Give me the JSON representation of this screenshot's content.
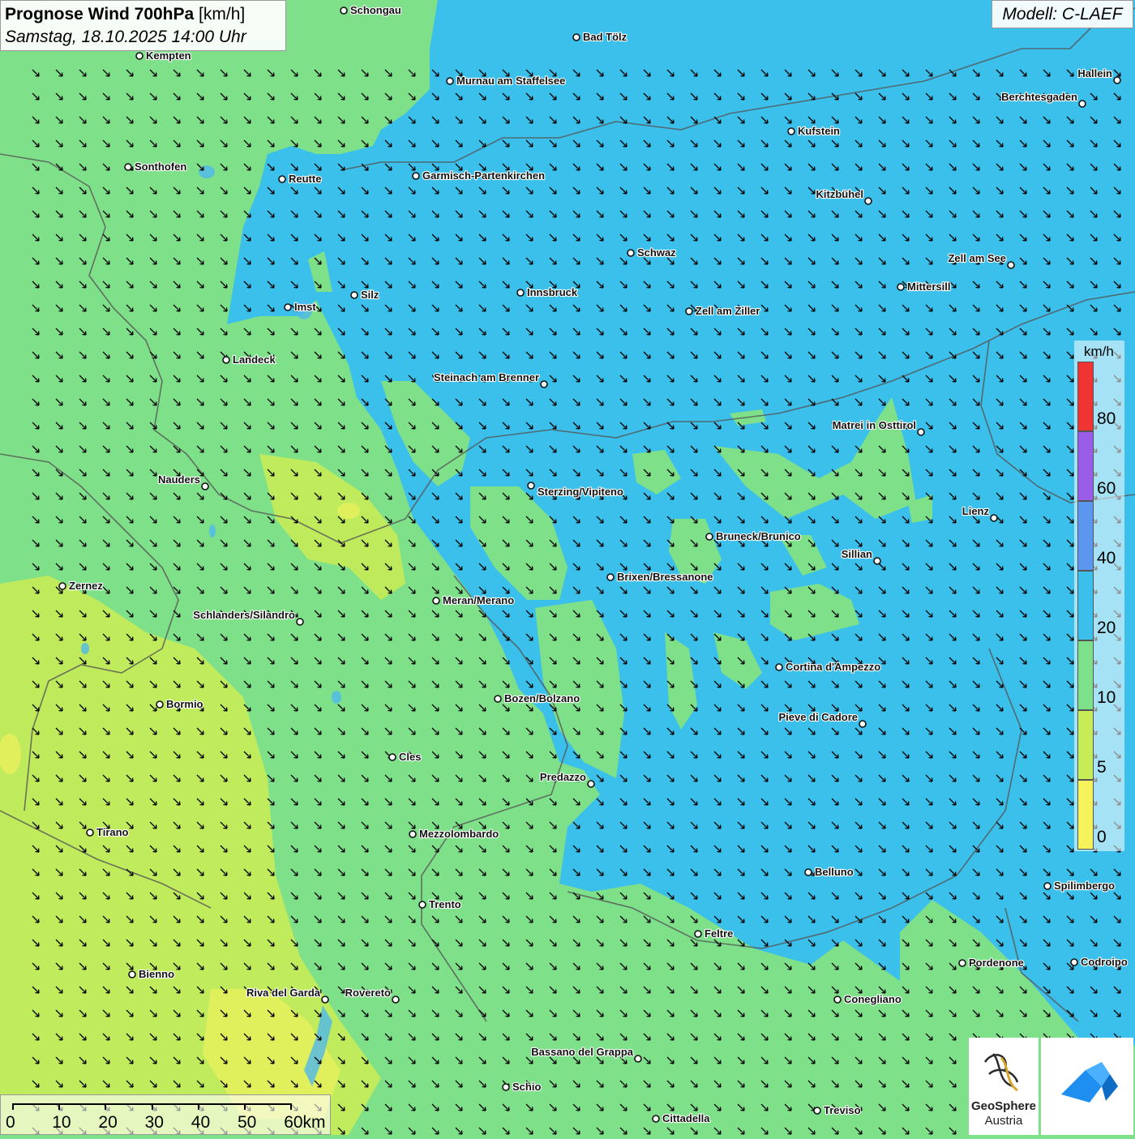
{
  "header": {
    "title": "Prognose Wind 700hPa",
    "unit": "[km/h]",
    "datetime": "Samstag, 18.10.2025 14:00 Uhr"
  },
  "model": "Modell: C-LAEF",
  "legend": {
    "unit": "km/h",
    "ticks": [
      "80",
      "60",
      "40",
      "20",
      "10",
      "5",
      "0"
    ],
    "colors": [
      "#f03434",
      "#9a5de8",
      "#5b97ef",
      "#3bbfeb",
      "#7fe08a",
      "#c6ec57",
      "#f6f25c"
    ]
  },
  "colors": {
    "wind_0_5": "#f6f25c",
    "wind_5_10": "#c6ec57",
    "wind_10_20": "#7fe08a",
    "wind_20_40": "#3bbfeb",
    "border": "#555555",
    "arrow": "#000000"
  },
  "wind_arrows": {
    "direction": "north-west wind blowing to south-east",
    "icon": "arrow-icon"
  },
  "scale_bar": [
    "0",
    "10",
    "20",
    "30",
    "40",
    "50",
    "60km"
  ],
  "logos": {
    "geosphere": "GeoSphere",
    "austria": "Austria"
  },
  "cities": [
    {
      "name": "Schongau"
    },
    {
      "name": "Bad Tölz"
    },
    {
      "name": "Kempten"
    },
    {
      "name": "Murnau am Staffelsee"
    },
    {
      "name": "Hallein"
    },
    {
      "name": "Berchtesgaden"
    },
    {
      "name": "Kufstein"
    },
    {
      "name": "Sonthofen"
    },
    {
      "name": "Reutte"
    },
    {
      "name": "Garmisch-Partenkirchen"
    },
    {
      "name": "Kitzbühel"
    },
    {
      "name": "Schwaz"
    },
    {
      "name": "Zell am See"
    },
    {
      "name": "Mittersill"
    },
    {
      "name": "Silz"
    },
    {
      "name": "Innsbruck"
    },
    {
      "name": "Imst"
    },
    {
      "name": "Zell am Ziller"
    },
    {
      "name": "Landeck"
    },
    {
      "name": "Steinach am Brenner"
    },
    {
      "name": "Matrei in Osttirol"
    },
    {
      "name": "Nauders"
    },
    {
      "name": "Sterzing/Vipiteno"
    },
    {
      "name": "Lienz"
    },
    {
      "name": "Bruneck/Brunico"
    },
    {
      "name": "Sillian"
    },
    {
      "name": "Zernez"
    },
    {
      "name": "Brixen/Bressanone"
    },
    {
      "name": "Meran/Merano"
    },
    {
      "name": "Schlanders/Silandro"
    },
    {
      "name": "Cortina d'Ampezzo"
    },
    {
      "name": "Bozen/Bolzano"
    },
    {
      "name": "Bormio"
    },
    {
      "name": "Pieve di Cadore"
    },
    {
      "name": "Cles"
    },
    {
      "name": "Predazzo"
    },
    {
      "name": "Tirano"
    },
    {
      "name": "Mezzolombardo"
    },
    {
      "name": "Belluno"
    },
    {
      "name": "Spilimbergo"
    },
    {
      "name": "Trento"
    },
    {
      "name": "Feltre"
    },
    {
      "name": "Pordenone"
    },
    {
      "name": "Codroipo"
    },
    {
      "name": "Bienno"
    },
    {
      "name": "Riva del Garda"
    },
    {
      "name": "Rovereto"
    },
    {
      "name": "Conegliano"
    },
    {
      "name": "Bassano del Grappa"
    },
    {
      "name": "Schio"
    },
    {
      "name": "Treviso"
    },
    {
      "name": "Cittadella"
    }
  ]
}
